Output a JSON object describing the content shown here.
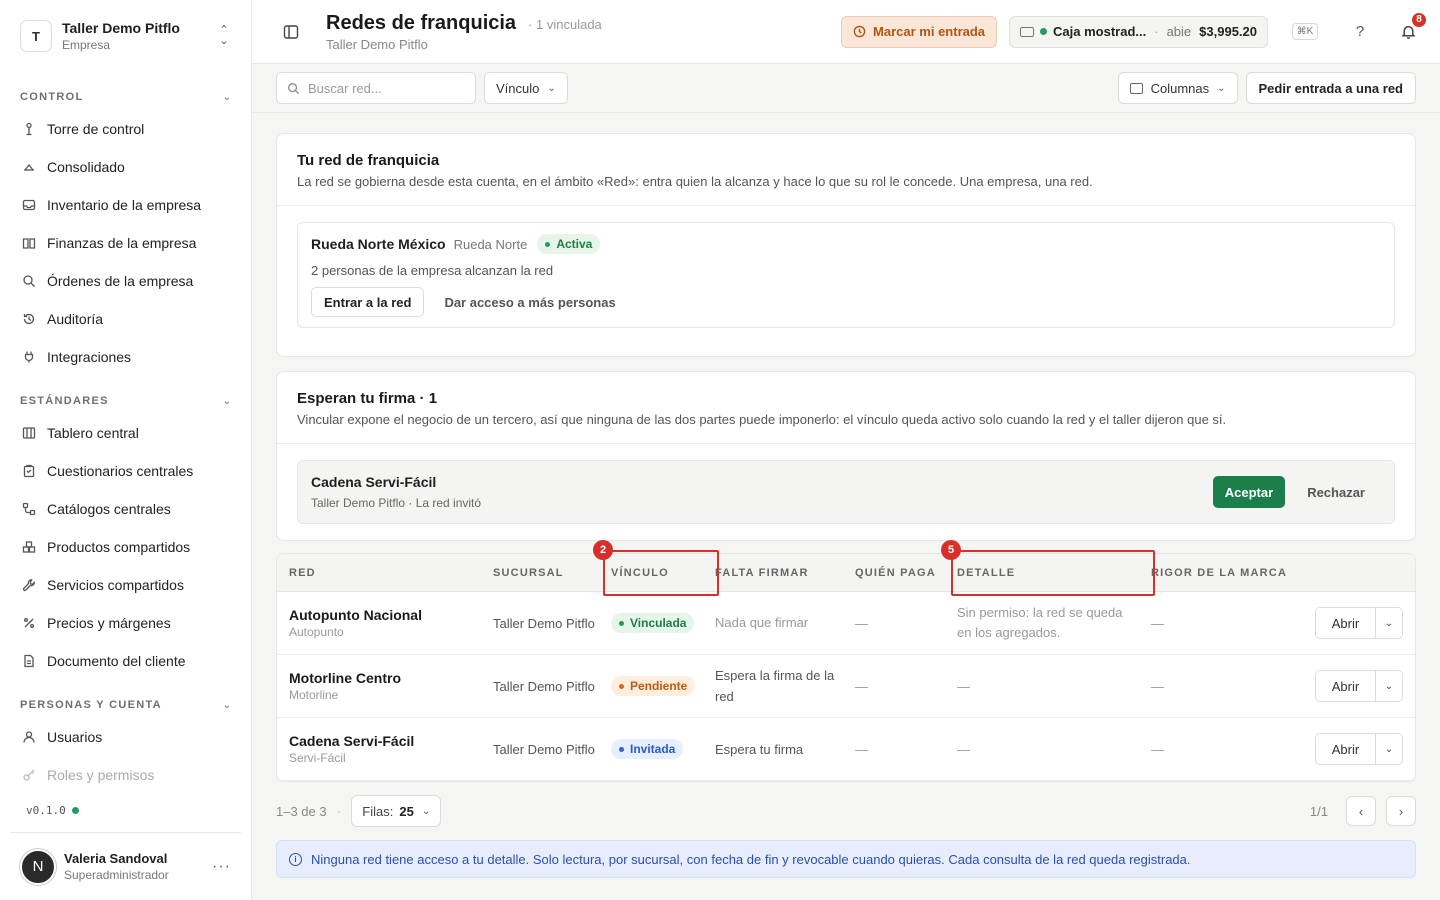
{
  "workspace": {
    "initial": "T",
    "name": "Taller Demo Pitflo",
    "type": "Empresa"
  },
  "sidebar": {
    "groups": [
      {
        "label": "CONTROL",
        "items": [
          {
            "label": "Torre de control",
            "icon": "tower-icon"
          },
          {
            "label": "Consolidado",
            "icon": "layers-icon"
          },
          {
            "label": "Inventario de la empresa",
            "icon": "inbox-icon"
          },
          {
            "label": "Finanzas de la empresa",
            "icon": "book-icon"
          },
          {
            "label": "Órdenes de la empresa",
            "icon": "search-icon"
          },
          {
            "label": "Auditoría",
            "icon": "history-icon"
          },
          {
            "label": "Integraciones",
            "icon": "plug-icon"
          }
        ]
      },
      {
        "label": "ESTÁNDARES",
        "items": [
          {
            "label": "Tablero central",
            "icon": "board-icon"
          },
          {
            "label": "Cuestionarios centrales",
            "icon": "clipboard-icon"
          },
          {
            "label": "Catálogos centrales",
            "icon": "catalog-icon"
          },
          {
            "label": "Productos compartidos",
            "icon": "boxes-icon"
          },
          {
            "label": "Servicios compartidos",
            "icon": "wrench-icon"
          },
          {
            "label": "Precios y márgenes",
            "icon": "percent-icon"
          },
          {
            "label": "Documento del cliente",
            "icon": "document-icon"
          }
        ]
      },
      {
        "label": "PERSONAS Y CUENTA",
        "items": [
          {
            "label": "Usuarios",
            "icon": "user-icon"
          },
          {
            "label": "Roles y permisos",
            "icon": "key-icon"
          }
        ]
      }
    ],
    "version": "v0.1.0"
  },
  "user": {
    "initial": "N",
    "name": "Valeria Sandoval",
    "role": "Superadministrador"
  },
  "header": {
    "title": "Redes de franquicia",
    "count": "1 vinculada",
    "subtitle": "Taller Demo Pitflo",
    "clock_label": "Marcar mi entrada",
    "register": {
      "name": "Caja mostrad...",
      "status": "abie",
      "amount": "$3,995.20"
    },
    "shortcut": "⌘K",
    "help": "?",
    "notifications": "8"
  },
  "toolbar": {
    "search_placeholder": "Buscar red...",
    "filter_label": "Vínculo",
    "columns_label": "Columnas",
    "request_label": "Pedir entrada a una red"
  },
  "own_network": {
    "title": "Tu red de franquicia",
    "description": "La red se gobierna desde esta cuenta, en el ámbito «Red»: entra quien la alcanza y hace lo que su rol le concede. Una empresa, una red.",
    "name": "Rueda Norte México",
    "short_name": "Rueda Norte",
    "status": "Activa",
    "reach": "2 personas de la empresa alcanzan la red",
    "enter_label": "Entrar a la red",
    "grant_label": "Dar acceso a más personas"
  },
  "pending": {
    "title": "Esperan tu firma · 1",
    "description": "Vincular expone el negocio de un tercero, así que ninguna de las dos partes puede imponerlo: el vínculo queda activo solo cuando la red y el taller dijeron que sí.",
    "name": "Cadena Servi-Fácil",
    "sub": "Taller Demo Pitflo · La red invitó",
    "accept_label": "Aceptar",
    "reject_label": "Rechazar"
  },
  "table": {
    "columns": [
      "RED",
      "SUCURSAL",
      "VÍNCULO",
      "FALTA FIRMAR",
      "QUIÉN PAGA",
      "DETALLE",
      "RIGOR DE LA MARCA"
    ],
    "rows": [
      {
        "name": "Autopunto Nacional",
        "short": "Autopunto",
        "branch": "Taller Demo Pitflo",
        "link": "Vinculada",
        "sign": "Nada que firmar",
        "payer": "—",
        "detail": "Sin permiso: la red se queda en los agregados.",
        "rigor": "—",
        "action": "Abrir"
      },
      {
        "name": "Motorline Centro",
        "short": "Motorline",
        "branch": "Taller Demo Pitflo",
        "link": "Pendiente",
        "sign": "Espera la firma de la red",
        "payer": "—",
        "detail": "—",
        "rigor": "—",
        "action": "Abrir"
      },
      {
        "name": "Cadena Servi-Fácil",
        "short": "Servi-Fácil",
        "branch": "Taller Demo Pitflo",
        "link": "Invitada",
        "sign": "Espera tu firma",
        "payer": "—",
        "detail": "—",
        "rigor": "—",
        "action": "Abrir"
      }
    ],
    "markers": [
      "2",
      "5"
    ]
  },
  "pagination": {
    "range": "1–3 de 3",
    "rows_label": "Filas:",
    "rows_value": "25",
    "page": "1/1"
  },
  "notice": "Ninguna red tiene acceso a tu detalle. Solo lectura, por sucursal, con fecha de fin y revocable cuando quieras. Cada consulta de la red queda registrada."
}
